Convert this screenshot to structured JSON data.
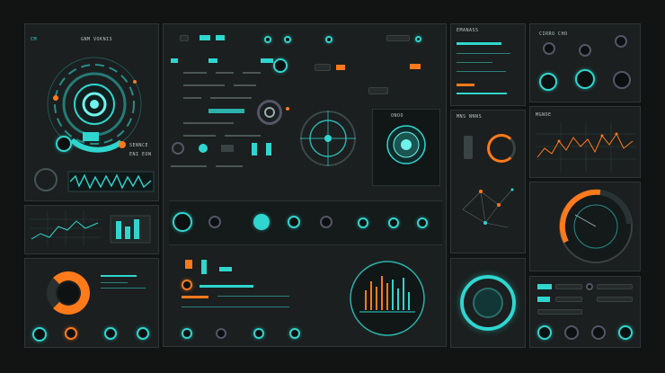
{
  "colors": {
    "cyan": "#2fd6cf",
    "orange": "#ff7a1a",
    "panel": "#1b1f1f",
    "bg": "#121414"
  },
  "panels": {
    "left_top": {
      "title": "GNM VOKNIS",
      "tag": "CM",
      "caption_a": "SENNCE",
      "caption_b": "ENI EON"
    },
    "center_top": {
      "title": ""
    },
    "scope_panel": {
      "title": "ONOO"
    },
    "right_top_a": {
      "title": "EMANASS"
    },
    "right_top_b": {
      "title": "CIRRO CHO"
    },
    "right_chart": {
      "title": "MGNOE"
    },
    "right_mid": {
      "title": "MNS NNNS"
    }
  },
  "readout": {
    "a": "SENNCE",
    "b": "ENI EON"
  },
  "icons": [
    "target-icon",
    "radar-icon",
    "waveform-icon",
    "gauge-icon",
    "crosshair-icon",
    "toggle-icon",
    "knob-icon",
    "bar-meter-icon"
  ]
}
